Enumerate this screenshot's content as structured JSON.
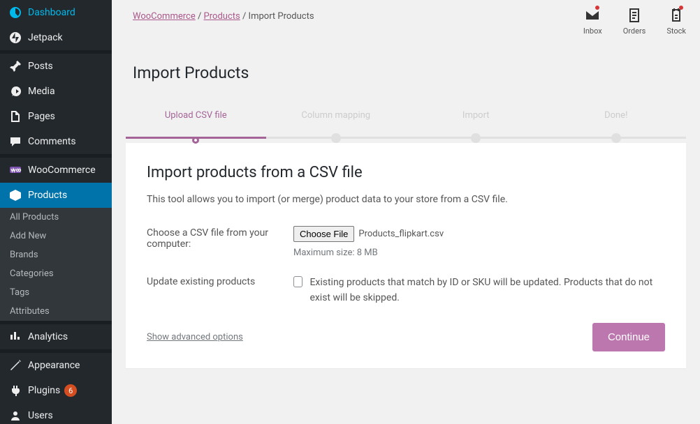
{
  "breadcrumb": {
    "items": [
      "WooCommerce",
      "Products"
    ],
    "current": "Import Products",
    "sep": " / "
  },
  "top_icons": {
    "inbox": {
      "label": "Inbox",
      "has_notif": true
    },
    "orders": {
      "label": "Orders",
      "has_notif": false
    },
    "stock": {
      "label": "Stock",
      "has_notif": true
    }
  },
  "page_title": "Import Products",
  "stepper": {
    "steps": [
      {
        "label": "Upload CSV file",
        "active": true
      },
      {
        "label": "Column mapping",
        "active": false
      },
      {
        "label": "Import",
        "active": false
      },
      {
        "label": "Done!",
        "active": false
      }
    ]
  },
  "card": {
    "title": "Import products from a CSV file",
    "desc": "This tool allows you to import (or merge) product data to your store from a CSV file.",
    "file_label": "Choose a CSV file from your computer:",
    "file_button": "Choose File",
    "file_name": "Products_flipkart.csv",
    "file_hint": "Maximum size: 8 MB",
    "update_label": "Update existing products",
    "update_desc": "Existing products that match by ID or SKU will be updated. Products that do not exist will be skipped.",
    "advanced": "Show advanced options",
    "continue": "Continue"
  },
  "sidebar": {
    "items": [
      {
        "label": "Dashboard",
        "icon": "dashboard"
      },
      {
        "label": "Jetpack",
        "icon": "jetpack"
      },
      {
        "type": "sep"
      },
      {
        "label": "Posts",
        "icon": "pin"
      },
      {
        "label": "Media",
        "icon": "media"
      },
      {
        "label": "Pages",
        "icon": "page"
      },
      {
        "label": "Comments",
        "icon": "comment"
      },
      {
        "type": "sep"
      },
      {
        "label": "WooCommerce",
        "icon": "woo"
      },
      {
        "label": "Products",
        "icon": "products",
        "active": true
      },
      {
        "type": "submenu",
        "items": [
          "All Products",
          "Add New",
          "Brands",
          "Categories",
          "Tags",
          "Attributes"
        ]
      },
      {
        "type": "sep"
      },
      {
        "label": "Analytics",
        "icon": "analytics"
      },
      {
        "type": "sep"
      },
      {
        "label": "Appearance",
        "icon": "appearance"
      },
      {
        "label": "Plugins",
        "icon": "plugins",
        "badge": "6"
      },
      {
        "label": "Users",
        "icon": "users"
      }
    ]
  }
}
